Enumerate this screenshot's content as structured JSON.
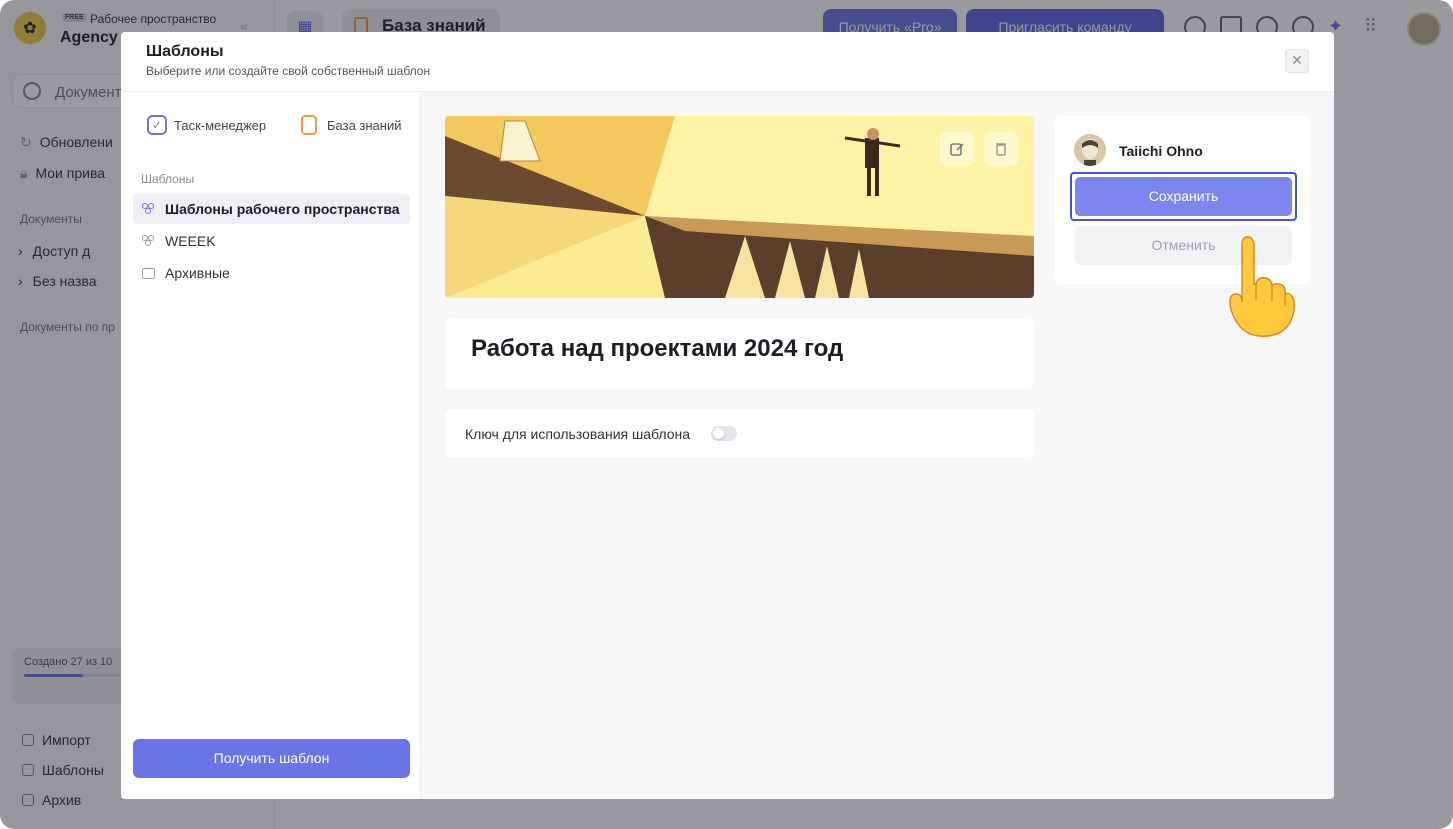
{
  "background": {
    "workspace": {
      "badge": "FREE",
      "label": "Рабочее пространство",
      "name": "Agency"
    },
    "sidebar": {
      "search_placeholder": "Документ",
      "items": [
        {
          "label": "Обновлени"
        },
        {
          "label": "Мои прива"
        }
      ],
      "section_documents": "Документы",
      "documents": [
        {
          "label": "Доступ д"
        },
        {
          "label": "Без назва"
        }
      ],
      "section_documents_by": "Документы по пр",
      "progress_text": "Создано 27 из 10",
      "progress_fraction": 0.27,
      "bottom_items": [
        {
          "label": "Импорт"
        },
        {
          "label": "Шаблоны"
        },
        {
          "label": "Архив"
        }
      ]
    },
    "header": {
      "breadcrumb": "База знаний",
      "pro_button": "Получить «Pro»",
      "invite_button": "Пригласить команду"
    }
  },
  "modal": {
    "title": "Шаблоны",
    "subtitle": "Выберите или создайте свой собственный шаблон",
    "close_label": "×",
    "tabs": [
      {
        "label": "Таск-менеджер"
      },
      {
        "label": "База знаний"
      }
    ],
    "section_label": "Шаблоны",
    "template_groups": [
      {
        "label": "Шаблоны рабочего пространства",
        "active": true
      },
      {
        "label": "WEEEK",
        "active": false
      },
      {
        "label": "Архивные",
        "active": false
      }
    ],
    "get_template_button": "Получить шаблон",
    "template": {
      "title": "Работа над проектами 2024 год",
      "key_label": "Ключ для использования шаблона",
      "key_enabled": false
    },
    "author": {
      "name": "Taiichi Ohno"
    },
    "save_button": "Сохранить",
    "cancel_button": "Отменить"
  },
  "colors": {
    "accent": "#6b74e6",
    "accent_dark": "#4a53d6",
    "orange": "#f39c3d"
  }
}
